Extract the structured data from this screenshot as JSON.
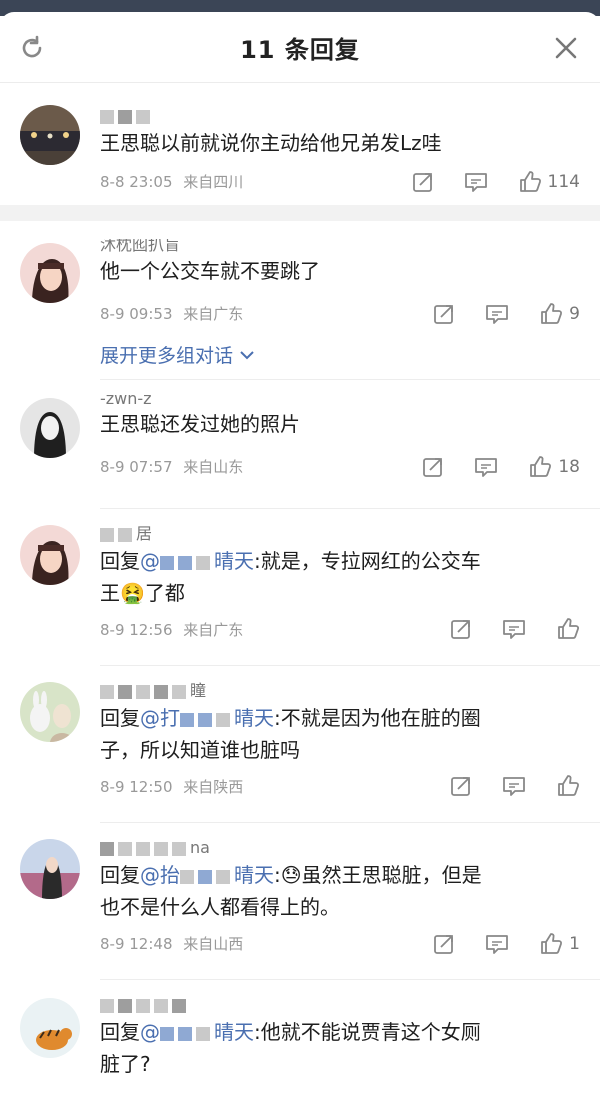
{
  "header": {
    "title": "11 条回复"
  },
  "main_comment": {
    "text": "王思聪以前就说你主动给他兄弟发Lz哇",
    "time": "8-8 23:05",
    "location": "来自四川",
    "likes": "114"
  },
  "replies": [
    {
      "username_fragment": "沐枕囮扒盲",
      "text": "他一个公交车就不要跳了",
      "time": "8-9 09:53",
      "location": "来自广东",
      "likes": "9",
      "expand_label": "展开更多组对话"
    },
    {
      "username_fragment": "-zwn-z",
      "text": "王思聪还发过她的照片",
      "time": "8-9 07:57",
      "location": "来自山东",
      "likes": "18"
    },
    {
      "username_fragment": "居",
      "prefix": "回复",
      "at": "@",
      "at_tail": "晴天",
      "text": ":就是，专拉网红的公交车",
      "text2": "王",
      "emoji": "🤮",
      "text3": "了都",
      "time": "8-9 12:56",
      "location": "来自广东",
      "likes": ""
    },
    {
      "username_fragment": "瞳",
      "prefix": "回复",
      "at": "@打",
      "at_tail": "晴天",
      "text": ":不就是因为他在脏的圈",
      "text2": "子，所以知道谁也脏吗",
      "time": "8-9 12:50",
      "location": "来自陕西",
      "likes": ""
    },
    {
      "username_fragment": "na",
      "prefix": "回复",
      "at": "@抬",
      "at_tail": "晴天",
      "text": ":😓虽然王思聪脏，但是",
      "text2": "也不是什么人都看得上的。",
      "time": "8-9 12:48",
      "location": "来自山西",
      "likes": "1"
    },
    {
      "username_fragment": "",
      "prefix": "回复",
      "at": "@",
      "at_tail": "晴天",
      "text": ":他就不能说贾青这个女厕",
      "text2": "脏了?",
      "time": "",
      "location": "",
      "likes": ""
    }
  ],
  "icons": {
    "refresh": "refresh-icon",
    "close": "close-icon",
    "share": "share-icon",
    "comment": "comment-icon",
    "like": "thumbs-up-icon",
    "expand": "chevron-down-icon"
  },
  "colors": {
    "link": "#4a6fb0",
    "meta": "#999999",
    "top_bar": "#3b4556"
  }
}
